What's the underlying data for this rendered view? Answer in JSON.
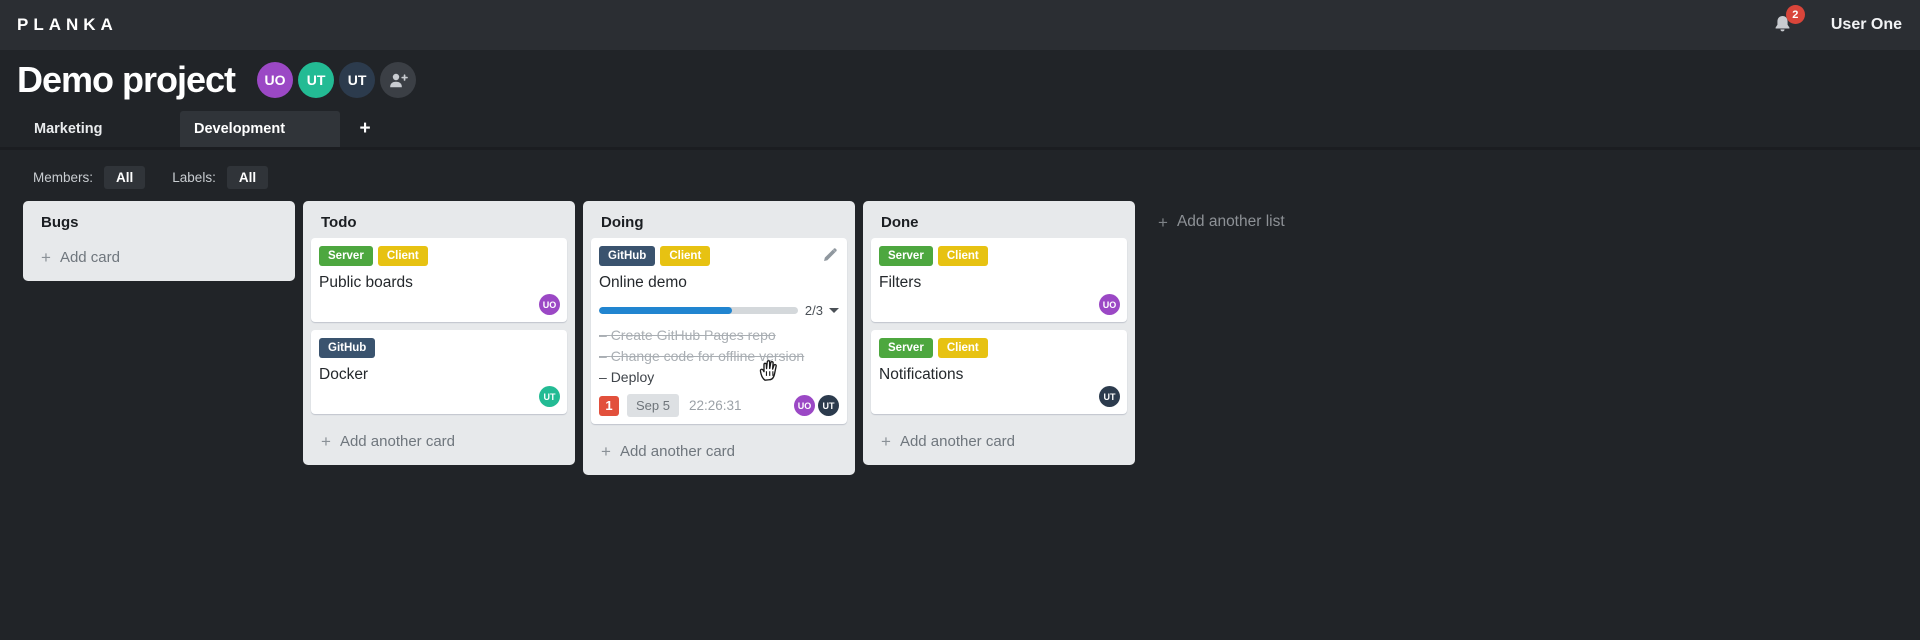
{
  "topbar": {
    "logo": "PLANKA",
    "notification_count": "2",
    "user_name": "User One"
  },
  "project": {
    "title": "Demo project",
    "members": [
      {
        "initials": "UO",
        "color": "#9b48c5"
      },
      {
        "initials": "UT",
        "color": "#23bb94"
      },
      {
        "initials": "UT",
        "color": "#2c3b4d"
      }
    ]
  },
  "tabs": [
    {
      "label": "Marketing",
      "active": false
    },
    {
      "label": "Development",
      "active": true
    }
  ],
  "add_tab_icon": "+",
  "filters": {
    "members_label": "Members:",
    "members_value": "All",
    "labels_label": "Labels:",
    "labels_value": "All"
  },
  "board": {
    "add_list_label": "Add another list",
    "lists": [
      {
        "name": "Bugs",
        "add_label": "Add card",
        "cards": []
      },
      {
        "name": "Todo",
        "add_label": "Add another card",
        "cards": [
          {
            "title": "Public boards",
            "labels": [
              {
                "text": "Server",
                "color": "#4da73f"
              },
              {
                "text": "Client",
                "color": "#e7c212"
              }
            ],
            "members": [
              {
                "initials": "UO",
                "color": "#9b48c5"
              }
            ]
          },
          {
            "title": "Docker",
            "labels": [
              {
                "text": "GitHub",
                "color": "#3a536e"
              }
            ],
            "members": [
              {
                "initials": "UT",
                "color": "#23bb94"
              }
            ]
          }
        ]
      },
      {
        "name": "Doing",
        "add_label": "Add another card",
        "cards": [
          {
            "title": "Online demo",
            "labels": [
              {
                "text": "GitHub",
                "color": "#3a536e"
              },
              {
                "text": "Client",
                "color": "#e7c212"
              }
            ],
            "has_edit_icon": true,
            "progress": {
              "completed": 2,
              "total": 3,
              "label": "2/3"
            },
            "tasks": [
              {
                "text": "Create GitHub Pages repo",
                "done": true
              },
              {
                "text": "Change code for offline version",
                "done": true
              },
              {
                "text": "Deploy",
                "done": false
              }
            ],
            "notification_count": "1",
            "due_date": "Sep 5",
            "timer": "22:26:31",
            "members": [
              {
                "initials": "UO",
                "color": "#9b48c5"
              },
              {
                "initials": "UT",
                "color": "#2c3b4d"
              }
            ]
          }
        ]
      },
      {
        "name": "Done",
        "add_label": "Add another card",
        "cards": [
          {
            "title": "Filters",
            "labels": [
              {
                "text": "Server",
                "color": "#4da73f"
              },
              {
                "text": "Client",
                "color": "#e7c212"
              }
            ],
            "members": [
              {
                "initials": "UO",
                "color": "#9b48c5"
              }
            ]
          },
          {
            "title": "Notifications",
            "labels": [
              {
                "text": "Server",
                "color": "#4da73f"
              },
              {
                "text": "Client",
                "color": "#e7c212"
              }
            ],
            "members": [
              {
                "initials": "UT",
                "color": "#2c3b4d"
              }
            ]
          }
        ]
      }
    ]
  },
  "icons": {
    "bell": "bell-icon",
    "user_plus": "user-plus-icon",
    "pencil": "pencil-icon",
    "plus": "+",
    "chevron_down": "chevron-down-icon",
    "hand_cursor": "hand-cursor"
  },
  "colors": {
    "topbar_bg": "#2b2e33",
    "page_bg": "#212428",
    "list_bg": "#e7e9eb",
    "progress_blue": "#2185d0",
    "notification_red": "#e2503c"
  }
}
